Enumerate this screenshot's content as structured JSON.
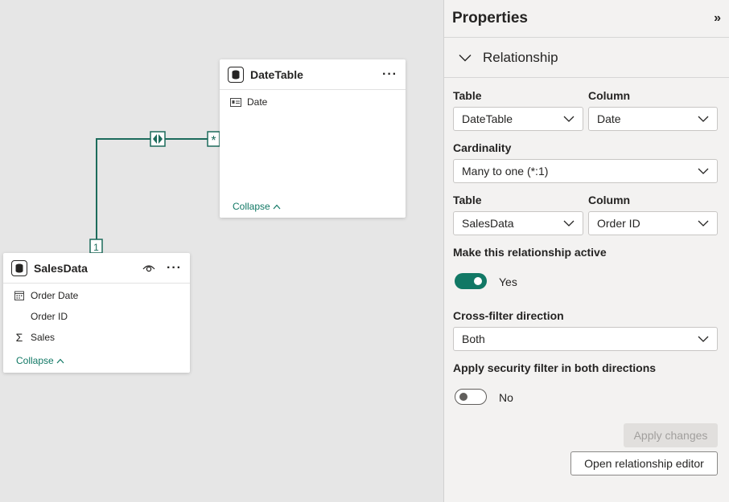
{
  "canvas": {
    "date_table": {
      "title": "DateTable",
      "fields": [
        {
          "icon": "calendar-card-icon",
          "label": "Date"
        }
      ],
      "collapse_label": "Collapse"
    },
    "sales_table": {
      "title": "SalesData",
      "fields": [
        {
          "icon": "calendar-icon",
          "label": "Order Date"
        },
        {
          "icon": "",
          "label": "Order ID"
        },
        {
          "icon": "sigma-icon",
          "label": "Sales"
        }
      ],
      "collapse_label": "Collapse"
    },
    "relationship": {
      "one_marker": "1",
      "many_marker": "*",
      "direction": "both"
    }
  },
  "panel": {
    "title": "Properties",
    "section": "Relationship",
    "table1_label": "Table",
    "column1_label": "Column",
    "table1_value": "DateTable",
    "column1_value": "Date",
    "cardinality_label": "Cardinality",
    "cardinality_value": "Many to one (*:1)",
    "table2_label": "Table",
    "column2_label": "Column",
    "table2_value": "SalesData",
    "column2_value": "Order ID",
    "active_label": "Make this relationship active",
    "active_state": "Yes",
    "crossfilter_label": "Cross-filter direction",
    "crossfilter_value": "Both",
    "security_label": "Apply security filter in both directions",
    "security_state": "No",
    "apply_button": "Apply changes",
    "open_editor_button": "Open relationship editor"
  },
  "colors": {
    "accent": "#117865",
    "relationship_line": "#1c6b5b"
  }
}
